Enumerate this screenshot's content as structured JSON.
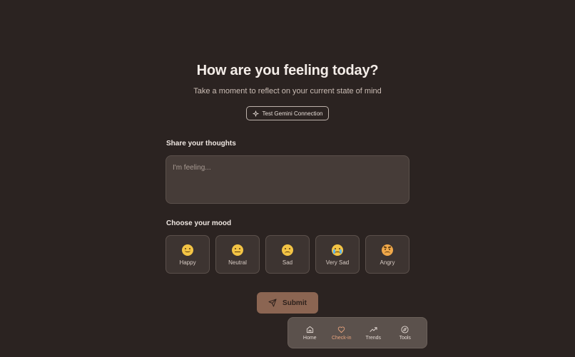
{
  "header": {
    "title": "How are you feeling today?",
    "subtitle": "Take a moment to reflect on your current state of mind",
    "test_button_label": "Test Gemini Connection",
    "test_button_icon": "sparkle-icon"
  },
  "thoughts": {
    "label": "Share your thoughts",
    "placeholder": "I'm feeling..."
  },
  "mood": {
    "label": "Choose your mood",
    "options": [
      {
        "label": "Happy",
        "icon": "happy-emoji-icon"
      },
      {
        "label": "Neutral",
        "icon": "neutral-emoji-icon"
      },
      {
        "label": "Sad",
        "icon": "sad-emoji-icon"
      },
      {
        "label": "Very Sad",
        "icon": "crying-emoji-icon"
      },
      {
        "label": "Angry",
        "icon": "angry-emoji-icon"
      }
    ]
  },
  "submit": {
    "label": "Submit",
    "icon": "send-icon"
  },
  "nav": {
    "active": "Check-in",
    "items": [
      {
        "label": "Home",
        "icon": "home-icon"
      },
      {
        "label": "Check-in",
        "icon": "heart-icon"
      },
      {
        "label": "Trends",
        "icon": "trending-up-icon"
      },
      {
        "label": "Tools",
        "icon": "compass-icon"
      }
    ]
  },
  "colors": {
    "background": "#2b2321",
    "accent": "#e9a47e",
    "submit_bg": "#8b6552"
  }
}
